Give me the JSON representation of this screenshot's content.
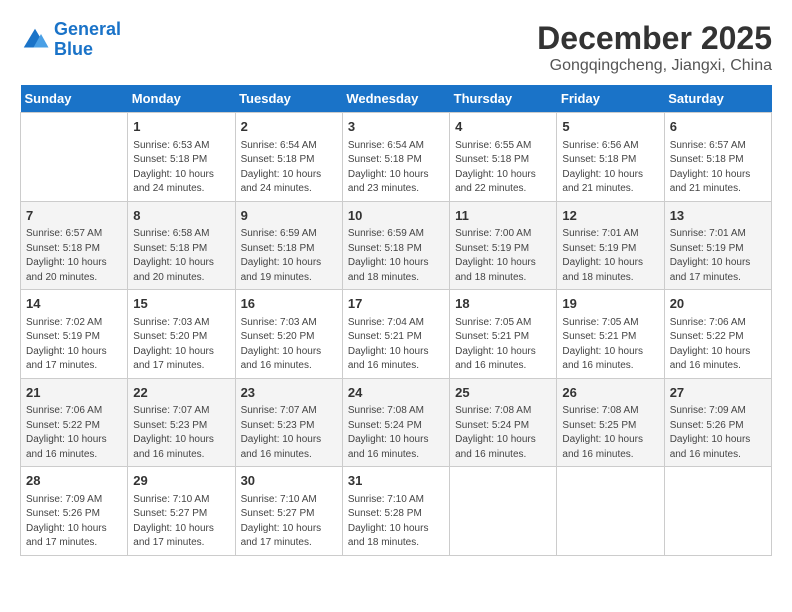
{
  "header": {
    "logo_line1": "General",
    "logo_line2": "Blue",
    "month": "December 2025",
    "location": "Gongqingcheng, Jiangxi, China"
  },
  "weekdays": [
    "Sunday",
    "Monday",
    "Tuesday",
    "Wednesday",
    "Thursday",
    "Friday",
    "Saturday"
  ],
  "weeks": [
    [
      {
        "day": "",
        "empty": true
      },
      {
        "day": "1",
        "sunrise": "6:53 AM",
        "sunset": "5:18 PM",
        "daylight": "10 hours and 24 minutes."
      },
      {
        "day": "2",
        "sunrise": "6:54 AM",
        "sunset": "5:18 PM",
        "daylight": "10 hours and 24 minutes."
      },
      {
        "day": "3",
        "sunrise": "6:54 AM",
        "sunset": "5:18 PM",
        "daylight": "10 hours and 23 minutes."
      },
      {
        "day": "4",
        "sunrise": "6:55 AM",
        "sunset": "5:18 PM",
        "daylight": "10 hours and 22 minutes."
      },
      {
        "day": "5",
        "sunrise": "6:56 AM",
        "sunset": "5:18 PM",
        "daylight": "10 hours and 21 minutes."
      },
      {
        "day": "6",
        "sunrise": "6:57 AM",
        "sunset": "5:18 PM",
        "daylight": "10 hours and 21 minutes."
      }
    ],
    [
      {
        "day": "7",
        "sunrise": "6:57 AM",
        "sunset": "5:18 PM",
        "daylight": "10 hours and 20 minutes."
      },
      {
        "day": "8",
        "sunrise": "6:58 AM",
        "sunset": "5:18 PM",
        "daylight": "10 hours and 20 minutes."
      },
      {
        "day": "9",
        "sunrise": "6:59 AM",
        "sunset": "5:18 PM",
        "daylight": "10 hours and 19 minutes."
      },
      {
        "day": "10",
        "sunrise": "6:59 AM",
        "sunset": "5:18 PM",
        "daylight": "10 hours and 18 minutes."
      },
      {
        "day": "11",
        "sunrise": "7:00 AM",
        "sunset": "5:19 PM",
        "daylight": "10 hours and 18 minutes."
      },
      {
        "day": "12",
        "sunrise": "7:01 AM",
        "sunset": "5:19 PM",
        "daylight": "10 hours and 18 minutes."
      },
      {
        "day": "13",
        "sunrise": "7:01 AM",
        "sunset": "5:19 PM",
        "daylight": "10 hours and 17 minutes."
      }
    ],
    [
      {
        "day": "14",
        "sunrise": "7:02 AM",
        "sunset": "5:19 PM",
        "daylight": "10 hours and 17 minutes."
      },
      {
        "day": "15",
        "sunrise": "7:03 AM",
        "sunset": "5:20 PM",
        "daylight": "10 hours and 17 minutes."
      },
      {
        "day": "16",
        "sunrise": "7:03 AM",
        "sunset": "5:20 PM",
        "daylight": "10 hours and 16 minutes."
      },
      {
        "day": "17",
        "sunrise": "7:04 AM",
        "sunset": "5:21 PM",
        "daylight": "10 hours and 16 minutes."
      },
      {
        "day": "18",
        "sunrise": "7:05 AM",
        "sunset": "5:21 PM",
        "daylight": "10 hours and 16 minutes."
      },
      {
        "day": "19",
        "sunrise": "7:05 AM",
        "sunset": "5:21 PM",
        "daylight": "10 hours and 16 minutes."
      },
      {
        "day": "20",
        "sunrise": "7:06 AM",
        "sunset": "5:22 PM",
        "daylight": "10 hours and 16 minutes."
      }
    ],
    [
      {
        "day": "21",
        "sunrise": "7:06 AM",
        "sunset": "5:22 PM",
        "daylight": "10 hours and 16 minutes."
      },
      {
        "day": "22",
        "sunrise": "7:07 AM",
        "sunset": "5:23 PM",
        "daylight": "10 hours and 16 minutes."
      },
      {
        "day": "23",
        "sunrise": "7:07 AM",
        "sunset": "5:23 PM",
        "daylight": "10 hours and 16 minutes."
      },
      {
        "day": "24",
        "sunrise": "7:08 AM",
        "sunset": "5:24 PM",
        "daylight": "10 hours and 16 minutes."
      },
      {
        "day": "25",
        "sunrise": "7:08 AM",
        "sunset": "5:24 PM",
        "daylight": "10 hours and 16 minutes."
      },
      {
        "day": "26",
        "sunrise": "7:08 AM",
        "sunset": "5:25 PM",
        "daylight": "10 hours and 16 minutes."
      },
      {
        "day": "27",
        "sunrise": "7:09 AM",
        "sunset": "5:26 PM",
        "daylight": "10 hours and 16 minutes."
      }
    ],
    [
      {
        "day": "28",
        "sunrise": "7:09 AM",
        "sunset": "5:26 PM",
        "daylight": "10 hours and 17 minutes."
      },
      {
        "day": "29",
        "sunrise": "7:10 AM",
        "sunset": "5:27 PM",
        "daylight": "10 hours and 17 minutes."
      },
      {
        "day": "30",
        "sunrise": "7:10 AM",
        "sunset": "5:27 PM",
        "daylight": "10 hours and 17 minutes."
      },
      {
        "day": "31",
        "sunrise": "7:10 AM",
        "sunset": "5:28 PM",
        "daylight": "10 hours and 18 minutes."
      },
      {
        "day": "",
        "empty": true
      },
      {
        "day": "",
        "empty": true
      },
      {
        "day": "",
        "empty": true
      }
    ]
  ]
}
